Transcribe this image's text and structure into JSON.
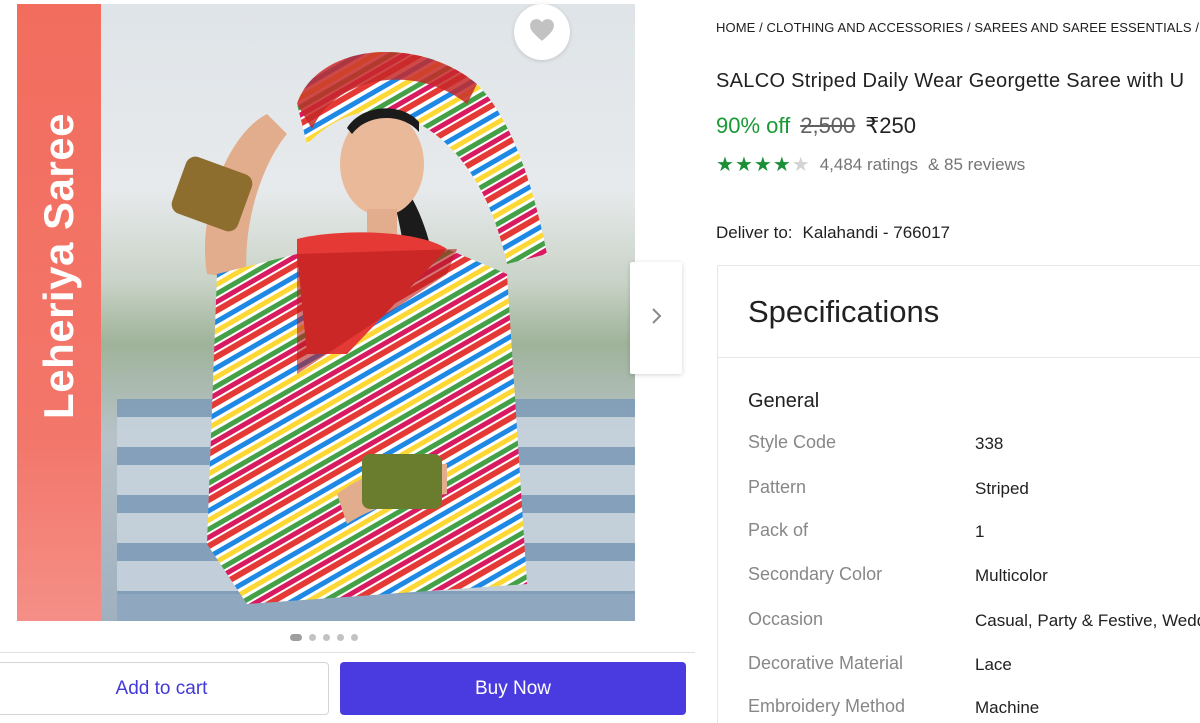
{
  "image": {
    "banner_text": "Leheriya Saree"
  },
  "colors": {
    "accent": "#4a3be0",
    "discount_green": "#1a9a35",
    "star_green": "#1b8f36",
    "banner_coral": "#f26d5e"
  },
  "breadcrumb": "HOME / CLOTHING AND ACCESSORIES / SAREES AND SAREE ESSENTIALS / SAR",
  "product": {
    "title": "SALCO Striped Daily Wear Georgette Saree with U",
    "discount": "90% off",
    "mrp": "2,500",
    "price": "₹250",
    "rating_stars": 4,
    "ratings": "4,484 ratings",
    "reviews": "& 85 reviews"
  },
  "delivery": {
    "label": "Deliver to:",
    "location": "Kalahandi - 766017"
  },
  "actions": {
    "add_to_cart": "Add to cart",
    "buy_now": "Buy Now"
  },
  "specifications": {
    "heading": "Specifications",
    "section": "General",
    "rows": [
      {
        "key": "Style Code",
        "value": "338"
      },
      {
        "key": "Pattern",
        "value": "Striped"
      },
      {
        "key": "Pack of",
        "value": "1"
      },
      {
        "key": "Secondary Color",
        "value": "Multicolor"
      },
      {
        "key": "Occasion",
        "value": "Casual, Party & Festive, Wedd"
      },
      {
        "key": "Decorative Material",
        "value": "Lace"
      },
      {
        "key": "Embroidery Method",
        "value": "Machine"
      }
    ]
  },
  "icons": {
    "wishlist": "heart-icon",
    "next": "chevron-right-icon"
  }
}
